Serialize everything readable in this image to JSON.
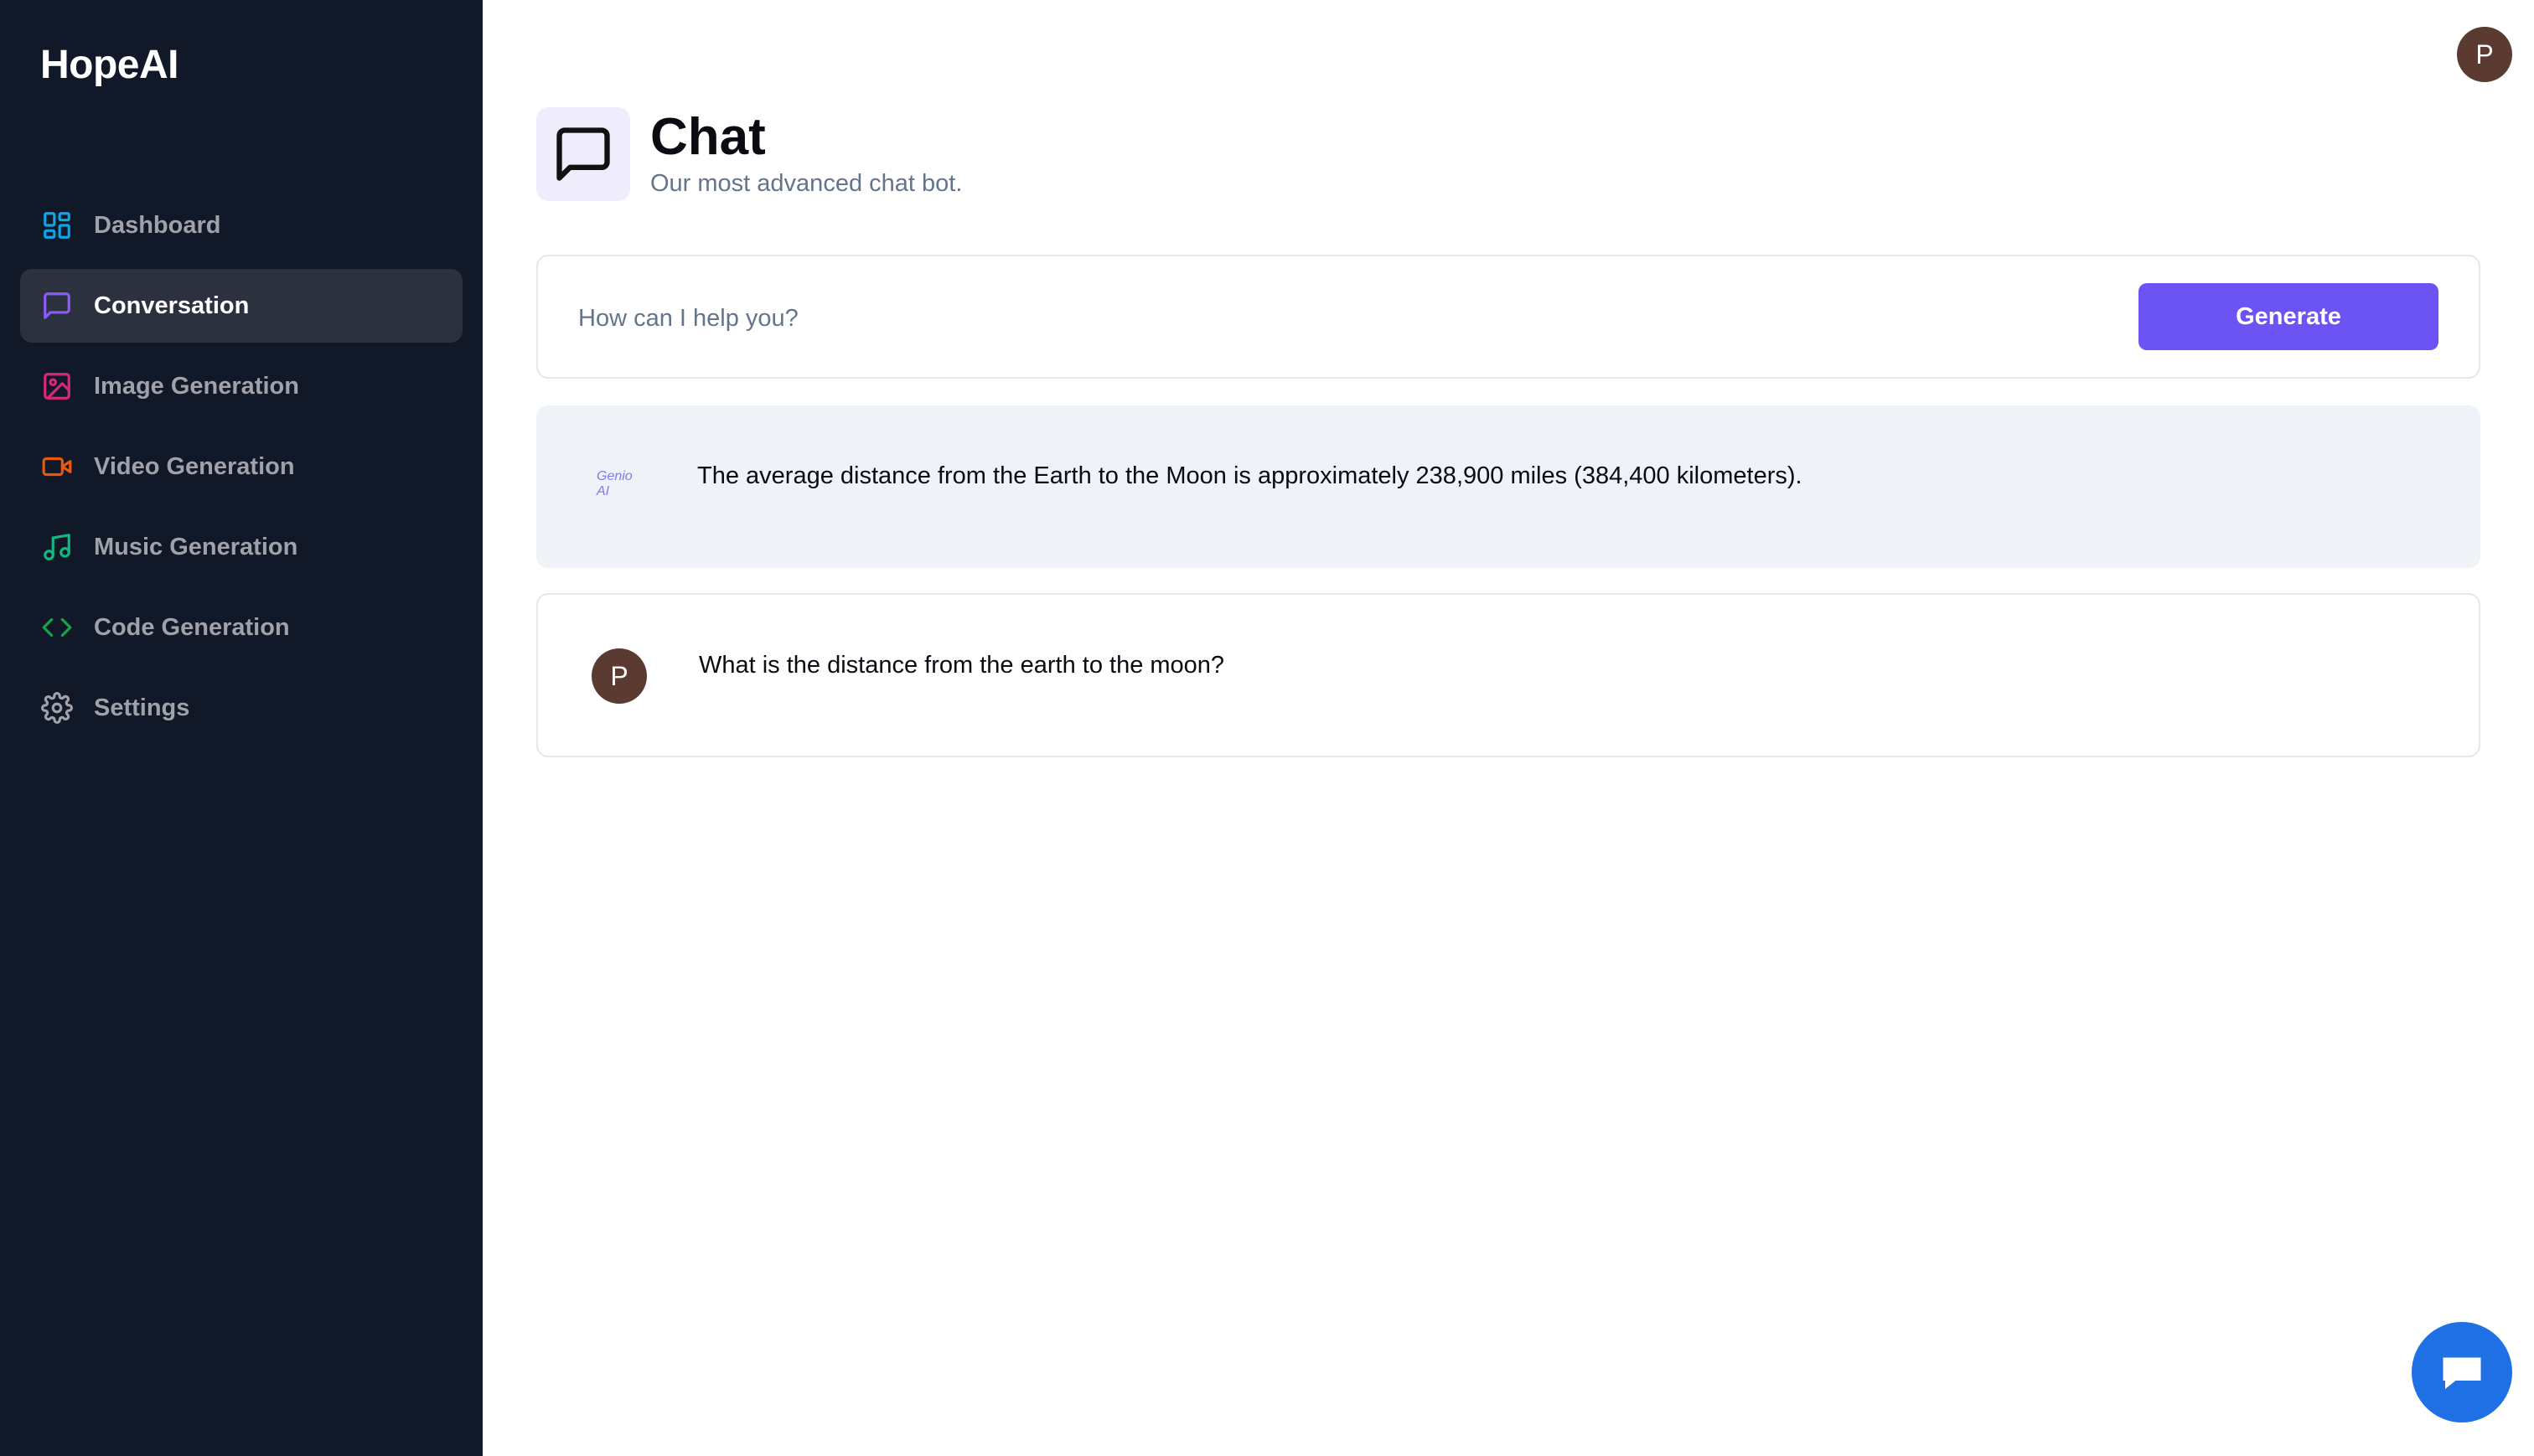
{
  "app": {
    "brand": "HopeAI"
  },
  "sidebar": {
    "items": [
      {
        "label": "Dashboard",
        "icon": "layout-dashboard-icon",
        "color": "#0ea5e9",
        "active": false
      },
      {
        "label": "Conversation",
        "icon": "message-square-icon",
        "color": "#8b5cf6",
        "active": true
      },
      {
        "label": "Image Generation",
        "icon": "image-icon",
        "color": "#db2777",
        "active": false
      },
      {
        "label": "Video Generation",
        "icon": "video-icon",
        "color": "#ea580c",
        "active": false
      },
      {
        "label": "Music Generation",
        "icon": "music-icon",
        "color": "#10b981",
        "active": false
      },
      {
        "label": "Code Generation",
        "icon": "code-icon",
        "color": "#16a34a",
        "active": false
      },
      {
        "label": "Settings",
        "icon": "settings-icon",
        "color": "#a1a1aa",
        "active": false
      }
    ]
  },
  "header": {
    "title": "Chat",
    "subtitle": "Our most advanced chat bot.",
    "icon": "message-square-icon",
    "avatar_initial": "P"
  },
  "prompt": {
    "placeholder": "How can I help you?",
    "value": "",
    "button_label": "Generate"
  },
  "messages": [
    {
      "role": "bot",
      "logo_text": "Genio AI",
      "text": "The average distance from the Earth to the Moon is approximately 238,900 miles (384,400 kilometers)."
    },
    {
      "role": "user",
      "avatar_initial": "P",
      "text": "What is the distance from the earth to the moon?"
    }
  ],
  "colors": {
    "sidebar_bg": "#111827",
    "accent": "#6c54f4",
    "support_button": "#1f6fe5"
  }
}
